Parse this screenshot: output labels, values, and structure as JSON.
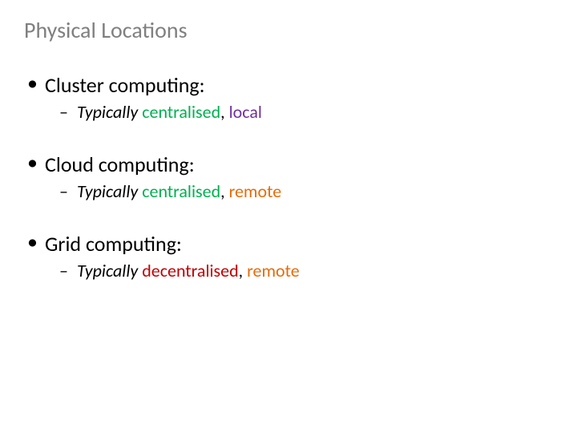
{
  "title": "Physical Locations",
  "items": [
    {
      "heading": "Cluster computing:",
      "sub": {
        "typically": "Typically",
        "word1": "centralised",
        "sep": ", ",
        "word2": "local"
      }
    },
    {
      "heading": "Cloud computing:",
      "sub": {
        "typically": "Typically",
        "word1": "centralised",
        "sep": ", ",
        "word2": "remote"
      }
    },
    {
      "heading": "Grid computing:",
      "sub": {
        "typically": "Typically",
        "word1": "decentralised",
        "sep": ", ",
        "word2": "remote"
      }
    }
  ]
}
